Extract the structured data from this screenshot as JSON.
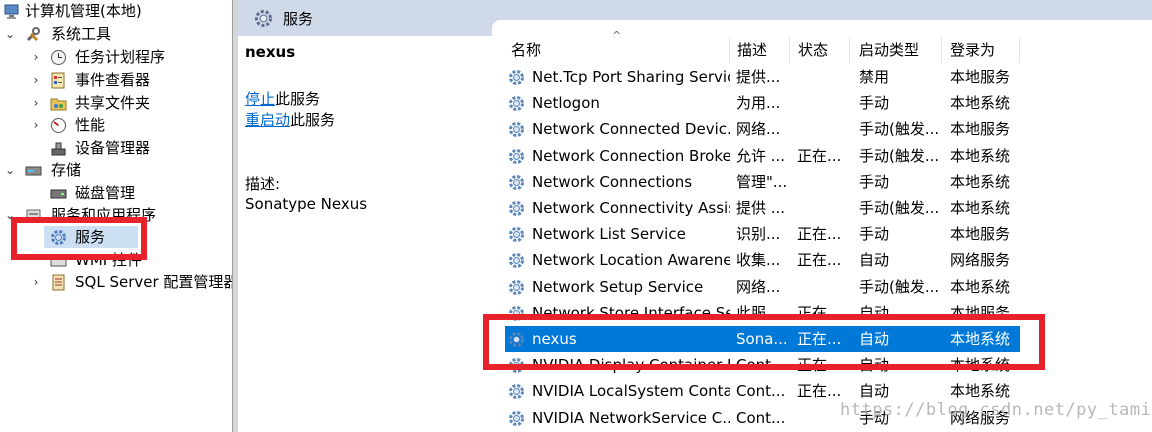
{
  "tree": {
    "root": "计算机管理(本地)",
    "system_tools": "系统工具",
    "task_scheduler": "任务计划程序",
    "event_viewer": "事件查看器",
    "shared_folders": "共享文件夹",
    "performance": "性能",
    "device_manager": "设备管理器",
    "storage": "存储",
    "disk_management": "磁盘管理",
    "services_apps": "服务和应用程序",
    "services": "服务",
    "wmi_control": "WMI 控件",
    "sql_server": "SQL Server 配置管理器"
  },
  "header": {
    "title": "服务"
  },
  "detail": {
    "service_name": "nexus",
    "stop_link": "停止",
    "stop_suffix": "此服务",
    "restart_link": "重启动",
    "restart_suffix": "此服务",
    "desc_label": "描述:",
    "desc_value": "Sonatype Nexus"
  },
  "columns": {
    "name": "名称",
    "sort_arrow": "^",
    "desc": "描述",
    "status": "状态",
    "startup": "启动类型",
    "logon": "登录为"
  },
  "services": [
    {
      "name": "Net.Tcp Port Sharing Service",
      "desc": "提供...",
      "status": "",
      "startup": "禁用",
      "logon": "本地服务"
    },
    {
      "name": "Netlogon",
      "desc": "为用...",
      "status": "",
      "startup": "手动",
      "logon": "本地系统"
    },
    {
      "name": "Network Connected Devic...",
      "desc": "网络...",
      "status": "",
      "startup": "手动(触发...",
      "logon": "本地服务"
    },
    {
      "name": "Network Connection Broker",
      "desc": "允许 ...",
      "status": "正在...",
      "startup": "手动(触发...",
      "logon": "本地系统"
    },
    {
      "name": "Network Connections",
      "desc": "管理\"...",
      "status": "",
      "startup": "手动",
      "logon": "本地系统"
    },
    {
      "name": "Network Connectivity Assis...",
      "desc": "提供 ...",
      "status": "",
      "startup": "手动(触发...",
      "logon": "本地系统"
    },
    {
      "name": "Network List Service",
      "desc": "识别...",
      "status": "正在...",
      "startup": "手动",
      "logon": "本地服务"
    },
    {
      "name": "Network Location Awarene...",
      "desc": "收集...",
      "status": "正在...",
      "startup": "自动",
      "logon": "网络服务"
    },
    {
      "name": "Network Setup Service",
      "desc": "网络...",
      "status": "",
      "startup": "手动(触发...",
      "logon": "本地系统"
    },
    {
      "name": "Network Store Interface Se...",
      "desc": "此服...",
      "status": "正在...",
      "startup": "自动",
      "logon": "本地服务"
    },
    {
      "name": "nexus",
      "desc": "Sona...",
      "status": "正在...",
      "startup": "自动",
      "logon": "本地系统"
    },
    {
      "name": "NVIDIA Display Container LS",
      "desc": "Cont...",
      "status": "正在...",
      "startup": "自动",
      "logon": "本地系统"
    },
    {
      "name": "NVIDIA LocalSystem Conta...",
      "desc": "Cont...",
      "status": "正在...",
      "startup": "自动",
      "logon": "本地系统"
    },
    {
      "name": "NVIDIA NetworkService C...",
      "desc": "Cont...",
      "status": "",
      "startup": "手动",
      "logon": "网络服务"
    }
  ],
  "selected_index": 10,
  "watermark": "https://blog.csdn.net/py_tamir",
  "colors": {
    "selection": "#0078d7",
    "highlight_box": "#e8222a",
    "header_bg": "#cfd9e7",
    "link": "#0066cc"
  }
}
